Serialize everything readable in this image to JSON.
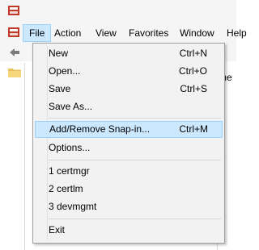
{
  "menubar": {
    "items": [
      {
        "label": "File",
        "open": true
      },
      {
        "label": "Action"
      },
      {
        "label": "View"
      },
      {
        "label": "Favorites"
      },
      {
        "label": "Window"
      },
      {
        "label": "Help"
      }
    ]
  },
  "right_pane": {
    "partial_text": "me"
  },
  "file_menu": {
    "groups": [
      [
        {
          "label": "New",
          "shortcut": "Ctrl+N"
        },
        {
          "label": "Open...",
          "shortcut": "Ctrl+O"
        },
        {
          "label": "Save",
          "shortcut": "Ctrl+S"
        },
        {
          "label": "Save As...",
          "shortcut": ""
        }
      ],
      [
        {
          "label": "Add/Remove Snap-in...",
          "shortcut": "Ctrl+M",
          "highlighted": true
        },
        {
          "label": "Options...",
          "shortcut": ""
        }
      ],
      [
        {
          "label": "1 certmgr",
          "shortcut": ""
        },
        {
          "label": "2 certlm",
          "shortcut": ""
        },
        {
          "label": "3 devmgmt",
          "shortcut": ""
        }
      ],
      [
        {
          "label": "Exit",
          "shortcut": ""
        }
      ]
    ]
  },
  "icons": {
    "app": "mmc-console-icon",
    "back": "back-arrow-icon",
    "tree_node": "folder-icon"
  },
  "colors": {
    "menu_highlight_bg": "#cce8ff",
    "menu_highlight_border": "#99d1ff",
    "menu_bg": "#f2f2f2"
  }
}
